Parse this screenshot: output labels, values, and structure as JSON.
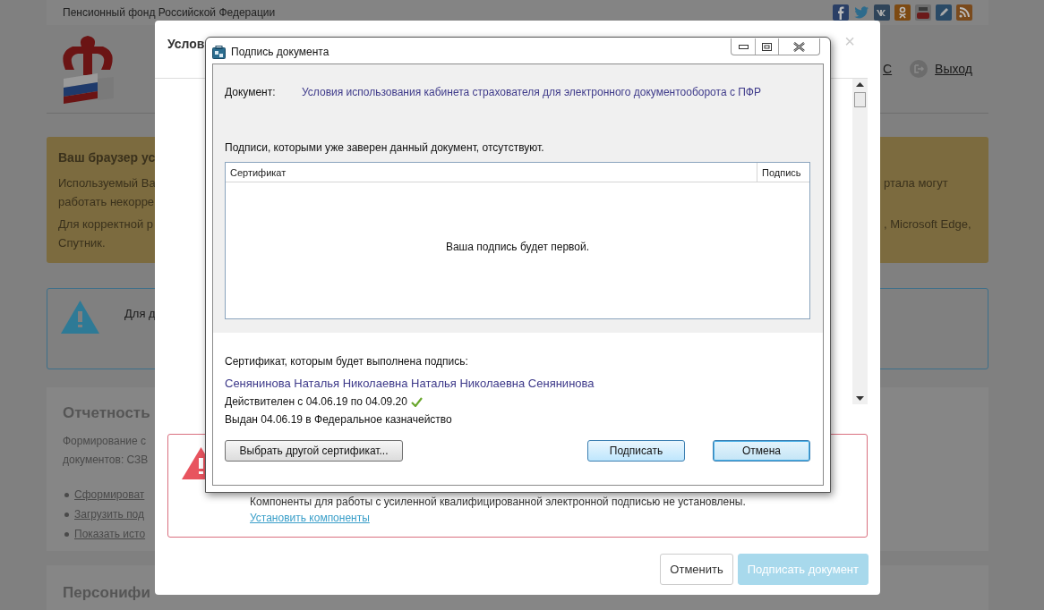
{
  "site": {
    "header_text": "Пенсионный фонд Российской Федерации",
    "nav_fragment": "С",
    "logout": "Выход"
  },
  "browser_warning": {
    "title": "Ваш браузер ус",
    "rows": [
      {
        "left": "Используемый Ва",
        "right": "ртала могут"
      },
      {
        "left": "работать некорре"
      },
      {
        "left": "Для корректной р",
        "right": ", Microsoft Edge,"
      },
      {
        "left": "Спутник."
      }
    ]
  },
  "info_box": {
    "text": "Для д"
  },
  "reporting_card": {
    "title": "Отчетность",
    "lines": [
      "Формирование с",
      "документов: СЗВ"
    ],
    "links": [
      "Сформироват",
      "Загрузить под",
      "Показать исто"
    ]
  },
  "next_card": {
    "title": "Персонифи"
  },
  "modal": {
    "title": "Услов",
    "close": "×",
    "alert": {
      "text": "Компоненты для работы с усиленной квалифицированной электронной подписью не установлены.",
      "link": "Установить компоненты"
    },
    "buttons": [
      {
        "label": "Отменить",
        "kind": "secondary",
        "disabled": false
      },
      {
        "label": "Подписать документ",
        "kind": "primary",
        "disabled": true
      }
    ]
  },
  "dialog": {
    "title": "Подпись документа",
    "document_label": "Документ:",
    "document_name": "Условия использования кабинета страхователя для электронного документооборота с ПФР",
    "signatures_note": "Подписи, которыми уже заверен данный документ, отсутствуют.",
    "table": {
      "columns": [
        "Сертификат",
        "Подпись"
      ],
      "empty_message": "Ваша подпись будет первой."
    },
    "certificate_heading": "Сертификат, которым будет выполнена подпись:",
    "certificate": {
      "owner": "Сенянинова Наталья Николаевна Наталья Николаевна Сенянинова",
      "validity": "Действителен с 04.06.19 по 04.09.20",
      "valid": true,
      "issuer": "Выдан 04.06.19 в Федеральное казначейство"
    },
    "buttons": [
      {
        "label": "Выбрать другой сертификат...",
        "kind": "normal"
      },
      {
        "label": "Подписать",
        "kind": "highlighted"
      },
      {
        "label": "Отмена",
        "kind": "default"
      }
    ]
  }
}
